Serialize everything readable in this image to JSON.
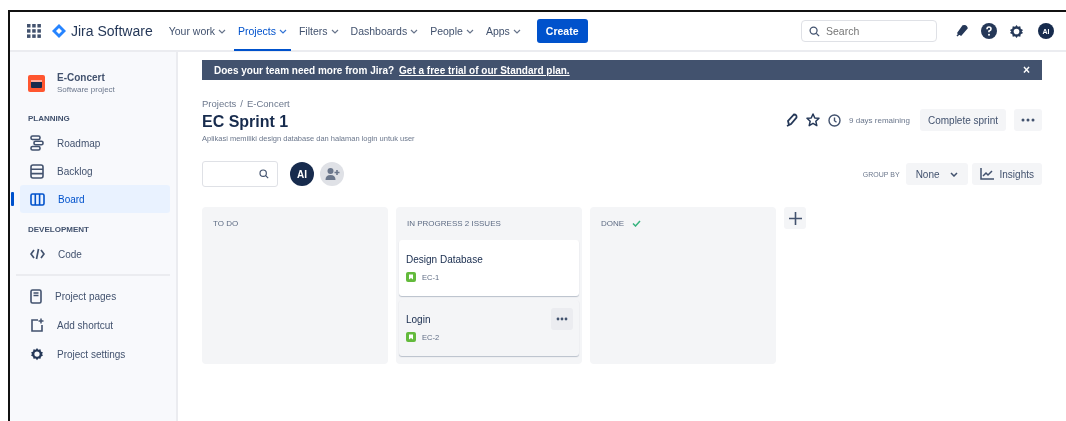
{
  "nav": {
    "app_name": "Jira Software",
    "items": [
      {
        "label": "Your work",
        "selected": false
      },
      {
        "label": "Projects",
        "selected": true
      },
      {
        "label": "Filters",
        "selected": false
      },
      {
        "label": "Dashboards",
        "selected": false
      },
      {
        "label": "People",
        "selected": false
      },
      {
        "label": "Apps",
        "selected": false
      }
    ],
    "create": "Create",
    "search": {
      "placeholder": "Search"
    },
    "avatar": "AI"
  },
  "sidebar": {
    "project": {
      "name": "E-Concert",
      "type": "Software project"
    },
    "sections": [
      {
        "heading": "PLANNING",
        "items": [
          {
            "label": "Roadmap",
            "kind": "roadmap",
            "selected": false
          },
          {
            "label": "Backlog",
            "kind": "backlog",
            "selected": false
          },
          {
            "label": "Board",
            "kind": "board",
            "selected": true
          }
        ]
      },
      {
        "heading": "DEVELOPMENT",
        "items": [
          {
            "label": "Code",
            "kind": "code",
            "selected": false
          }
        ]
      }
    ],
    "footer_items": [
      {
        "label": "Project pages",
        "kind": "page",
        "selected": false
      },
      {
        "label": "Add shortcut",
        "kind": "shortcut",
        "selected": false
      },
      {
        "label": "Project settings",
        "kind": "settings",
        "selected": false
      }
    ]
  },
  "banner": {
    "text": "Does your team need more from Jira?",
    "link": "Get a free trial of our Standard plan.",
    "close": "×"
  },
  "breadcrumbs": {
    "items": [
      "Projects",
      "E-Concert"
    ],
    "separator": "/"
  },
  "sprint": {
    "title": "EC Sprint 1",
    "goal": "Aplikasi memiliki design database dan halaman login untuk user",
    "remaining": "9 days remaining",
    "complete": "Complete sprint"
  },
  "toolbar": {
    "avatar": "AI",
    "group_by": "GROUP BY",
    "group_value": "None",
    "insights": "Insights"
  },
  "columns": [
    {
      "title": "TO DO",
      "done": false
    },
    {
      "title": "IN PROGRESS 2 ISSUES",
      "done": false,
      "issues": [
        {
          "title": "Design Database",
          "key": "EC-1",
          "hovered": false
        },
        {
          "title": "Login",
          "key": "EC-2",
          "hovered": true
        }
      ]
    },
    {
      "title": "DONE",
      "done": true
    }
  ]
}
